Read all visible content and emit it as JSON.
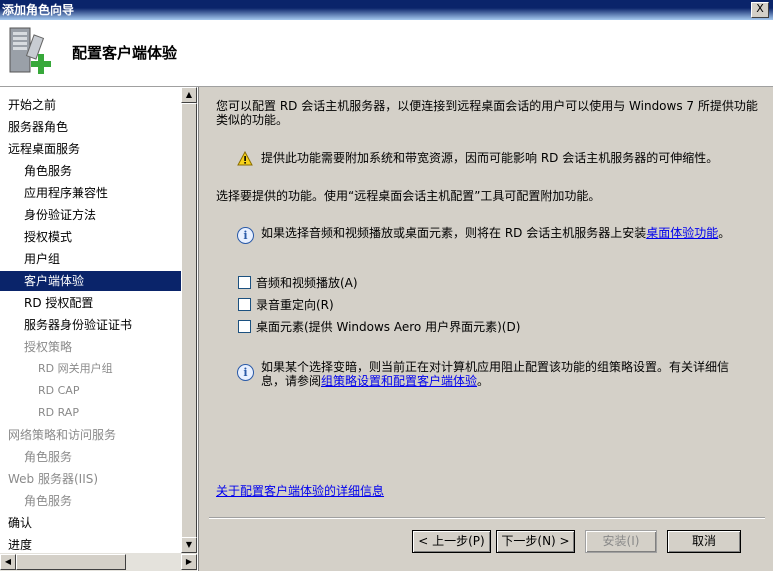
{
  "window": {
    "title": "添加角色向导",
    "close_label": "X"
  },
  "header": {
    "heading": "配置客户端体验",
    "icon": "server-add-role-icon"
  },
  "sidebar": {
    "items": [
      {
        "label": "开始之前",
        "level": 0,
        "state": "normal"
      },
      {
        "label": "服务器角色",
        "level": 0,
        "state": "normal"
      },
      {
        "label": "远程桌面服务",
        "level": 0,
        "state": "normal"
      },
      {
        "label": "角色服务",
        "level": 1,
        "state": "normal"
      },
      {
        "label": "应用程序兼容性",
        "level": 1,
        "state": "normal"
      },
      {
        "label": "身份验证方法",
        "level": 1,
        "state": "normal"
      },
      {
        "label": "授权模式",
        "level": 1,
        "state": "normal"
      },
      {
        "label": "用户组",
        "level": 1,
        "state": "normal"
      },
      {
        "label": "客户端体验",
        "level": 1,
        "state": "selected"
      },
      {
        "label": "RD 授权配置",
        "level": 1,
        "state": "normal"
      },
      {
        "label": "服务器身份验证证书",
        "level": 1,
        "state": "normal"
      },
      {
        "label": "授权策略",
        "level": 1,
        "state": "dim"
      },
      {
        "label": "RD 网关用户组",
        "level": 2,
        "state": "dim"
      },
      {
        "label": "RD CAP",
        "level": 2,
        "state": "dim"
      },
      {
        "label": "RD RAP",
        "level": 2,
        "state": "dim"
      },
      {
        "label": "网络策略和访问服务",
        "level": 0,
        "state": "dim"
      },
      {
        "label": "角色服务",
        "level": 1,
        "state": "dim"
      },
      {
        "label": "Web 服务器(IIS)",
        "level": 0,
        "state": "dim"
      },
      {
        "label": "角色服务",
        "level": 1,
        "state": "dim"
      },
      {
        "label": "确认",
        "level": 0,
        "state": "normal"
      },
      {
        "label": "进度",
        "level": 0,
        "state": "normal"
      }
    ]
  },
  "main": {
    "intro_line1": "您可以配置 RD 会话主机服务器，以便连接到远程桌面会话的用户可以使用与 Windows 7 所提供功能",
    "intro_line2": "类似的功能。",
    "warning_text": "提供此功能需要附加系统和带宽资源，因而可能影响 RD 会话主机服务器的可伸缩性。",
    "select_prompt": "选择要提供的功能。使用“远程桌面会话主机配置”工具可配置附加功能。",
    "info1_text": "如果选择音频和视频播放或桌面元素，则将在 RD 会话主机服务器上安装",
    "info1_link": "桌面体验功能",
    "info1_tail": "。",
    "options": [
      {
        "label": "音频和视频播放(A)",
        "checked": false
      },
      {
        "label": "录音重定向(R)",
        "checked": false
      },
      {
        "label": "桌面元素(提供 Windows Aero 用户界面元素)(D)",
        "checked": false
      }
    ],
    "info2_line1": "如果某个选择变暗，则当前正在对计算机应用阻止配置该功能的组策略设置。有关详细信",
    "info2_line2_prefix": "息，请参阅",
    "info2_link": "组策略设置和配置客户端体验",
    "info2_tail": "。",
    "more_info_link": "关于配置客户端体验的详细信息"
  },
  "buttons": {
    "back": "< 上一步(P)",
    "next": "下一步(N) >",
    "install": "安装(I)",
    "cancel": "取消"
  },
  "colors": {
    "selection": "#0a246a",
    "link": "#0000ee",
    "dialog_bg": "#d4d0c8"
  }
}
